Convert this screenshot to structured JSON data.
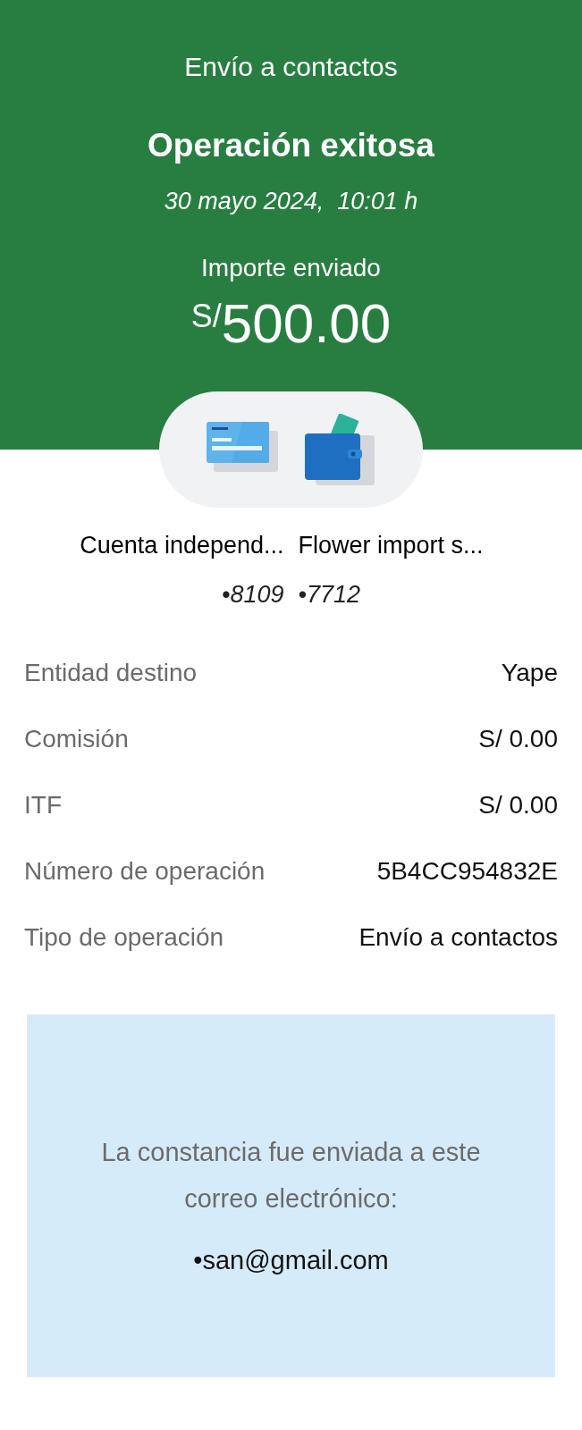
{
  "header": {
    "title": "Envío a contactos",
    "status": "Operación exitosa",
    "datetime": "30 mayo 2024,  10:01 h",
    "amount_label": "Importe enviado",
    "currency": "S/",
    "amount": "500.00"
  },
  "accounts": [
    {
      "kind": "card",
      "name": "Cuenta independ...",
      "number": "•8109"
    },
    {
      "kind": "wallet",
      "name": "Flower import s...",
      "number": "•7712"
    }
  ],
  "details": [
    {
      "label": "Entidad destino",
      "value": "Yape"
    },
    {
      "label": "Comisión",
      "value": "S/ 0.00"
    },
    {
      "label": "ITF",
      "value": "S/ 0.00"
    },
    {
      "label": "Número de operación",
      "value": "5B4CC954832E"
    },
    {
      "label": "Tipo de operación",
      "value": "Envío a contactos"
    }
  ],
  "notice": {
    "message": "La constancia fue enviada a este correo electrónico:",
    "email": "•san@gmail.com"
  }
}
